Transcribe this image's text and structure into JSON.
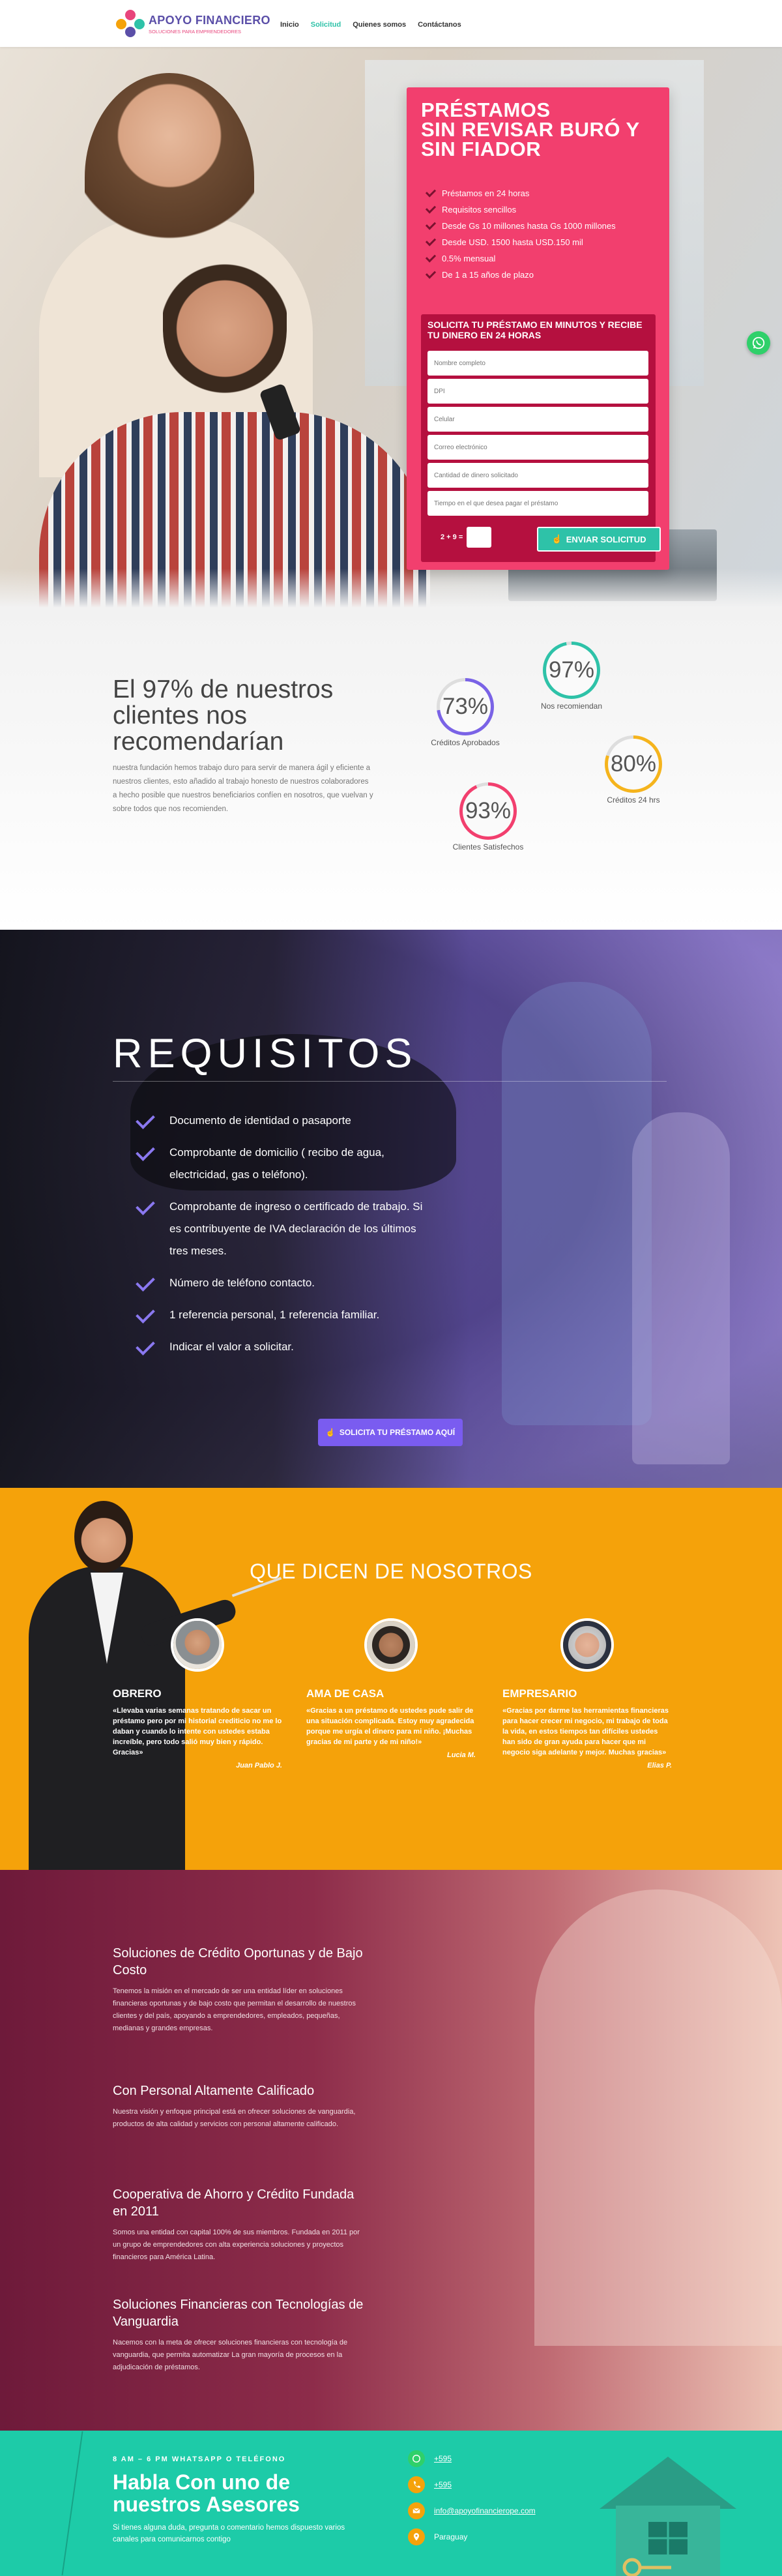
{
  "header": {
    "logo_title": "APOYO FINANCIERO",
    "logo_subtitle": "SOLUCIONES PARA EMPRENDEDORES",
    "nav": [
      {
        "label": "Inicio",
        "active": false
      },
      {
        "label": "Solicitud",
        "active": true
      },
      {
        "label": "Quienes somos",
        "active": false
      },
      {
        "label": "Contáctanos",
        "active": false
      }
    ]
  },
  "hero": {
    "title_lines": [
      "PRÉSTAMOS",
      "SIN REVISAR BURÓ Y",
      "SIN FIADOR"
    ],
    "benefits": [
      "Préstamos en 24 horas",
      "Requisitos sencillos",
      "Desde Gs 10 millones hasta Gs 1000 millones",
      "Desde USD. 1500 hasta USD.150 mil",
      "0.5% mensual",
      "De 1 a 15 años de plazo"
    ],
    "form": {
      "title": "SOLICITA TU PRÉSTAMO EN MINUTOS Y RECIBE TU DINERO EN 24 HORAS",
      "fields": [
        "Nombre completo",
        "DPI",
        "Celular",
        "Correo electrónico",
        "Cantidad de dinero solicitado",
        "Tiempo en el que desea pagar el préstamo"
      ],
      "captcha": "2 + 9 =",
      "submit": "ENVIAR SOLICITUD"
    }
  },
  "stats": {
    "heading": "El 97% de nuestros clientes nos recomendarían",
    "paragraph": "nuestra fundación hemos trabajo duro para servir de manera ágil y eficiente a nuestros clientes, esto añadido al trabajo honesto de nuestros colaboradores a hecho posible que nuestros beneficiarios confíen en nosotros, que vuelvan y sobre todos que nos recomienden.",
    "items": [
      {
        "value": "73%",
        "label": "Créditos Aprobados",
        "percent": 73,
        "color": "#7a63e6"
      },
      {
        "value": "97%",
        "label": "Nos recomiendan",
        "percent": 97,
        "color": "#2ec2a8"
      },
      {
        "value": "80%",
        "label": "Créditos 24 hrs",
        "percent": 80,
        "color": "#f5b41d"
      },
      {
        "value": "93%",
        "label": "Clientes Satisfechos",
        "percent": 93,
        "color": "#f23f6e"
      }
    ]
  },
  "requisitos": {
    "title": "REQUISITOS",
    "items": [
      "Documento de identidad o pasaporte",
      "Comprobante de domicilio ( recibo de agua, electricidad, gas o teléfono).",
      "Comprobante de ingreso o certificado de trabajo. Si es contribuyente de IVA declaración de los últimos tres meses.",
      "Número de teléfono contacto.",
      "1 referencia personal, 1 referencia familiar.",
      "Indicar el valor a solicitar."
    ],
    "button": "SOLICITA TU PRÉSTAMO AQUÍ"
  },
  "testimonials": {
    "title": "QUE DICEN DE NOSOTROS",
    "items": [
      {
        "role": "OBRERO",
        "quote": "«Llevaba varias semanas tratando de sacar un préstamo pero por mi historial crediticio no me lo daban y cuando lo intente con ustedes estaba increíble, pero todo salió muy bien y rápido. Gracias»",
        "author": "Juan Pablo J."
      },
      {
        "role": "AMA DE CASA",
        "quote": "«Gracias a un préstamo de ustedes pude salir de una situación complicada. Estoy muy agradecida porque me urgía el dinero para mi niño. ¡Muchas gracias de mi parte y de mi niño!»",
        "author": "Lucia M."
      },
      {
        "role": "EMPRESARIO",
        "quote": "«Gracias por darme las herramientas financieras para hacer crecer mi negocio, mi trabajo de toda la vida, en estos tiempos tan difíciles ustedes han sido de gran ayuda para hacer que mi negocio siga adelante y mejor. Muchas gracias»",
        "author": "Elias P."
      }
    ]
  },
  "about": {
    "items": [
      {
        "title": "Soluciones de Crédito Oportunas y de Bajo Costo",
        "text": "Tenemos la misión en el mercado de ser una entidad líder en soluciones financieras oportunas y de bajo costo que permitan el desarrollo de nuestros clientes y del país, apoyando a emprendedores, empleados, pequeñas, medianas y grandes empresas."
      },
      {
        "title": "Con Personal Altamente Calificado",
        "text": "Nuestra visión y enfoque principal está en ofrecer soluciones de vanguardia, productos de alta calidad y servicios con personal altamente calificado."
      },
      {
        "title": "Cooperativa de Ahorro y Crédito Fundada en 2011",
        "text": "Somos una entidad con capital 100% de sus miembros. Fundada en 2011 por un grupo de emprendedores con alta experiencia soluciones y proyectos financieros para América Latina."
      },
      {
        "title": "Soluciones Financieras con Tecnologías de Vanguardia",
        "text": "Nacemos con la meta de ofrecer soluciones financieras con tecnología de vanguardia, que permita automatizar La gran mayoría de procesos en la adjudicación de préstamos."
      }
    ]
  },
  "footer": {
    "eyebrow": "8 AM – 6 PM WHATSAPP O TELÉFONO",
    "heading": "Habla Con uno de nuestros Asesores",
    "paragraph": "Si tienes alguna duda, pregunta o comentario hemos dispuesto varios canales para comunicarnos contigo",
    "contacts": [
      {
        "icon": "whatsapp-icon",
        "text": "+595",
        "color": "#2fd06a"
      },
      {
        "icon": "phone-icon",
        "text": "+595",
        "color": "#f5a20a"
      },
      {
        "icon": "mail-icon",
        "text": "info@apoyofinancierope.com",
        "color": "#f5a20a"
      },
      {
        "icon": "location-icon",
        "text": "Paraguay",
        "color": "#f5a20a"
      }
    ]
  }
}
